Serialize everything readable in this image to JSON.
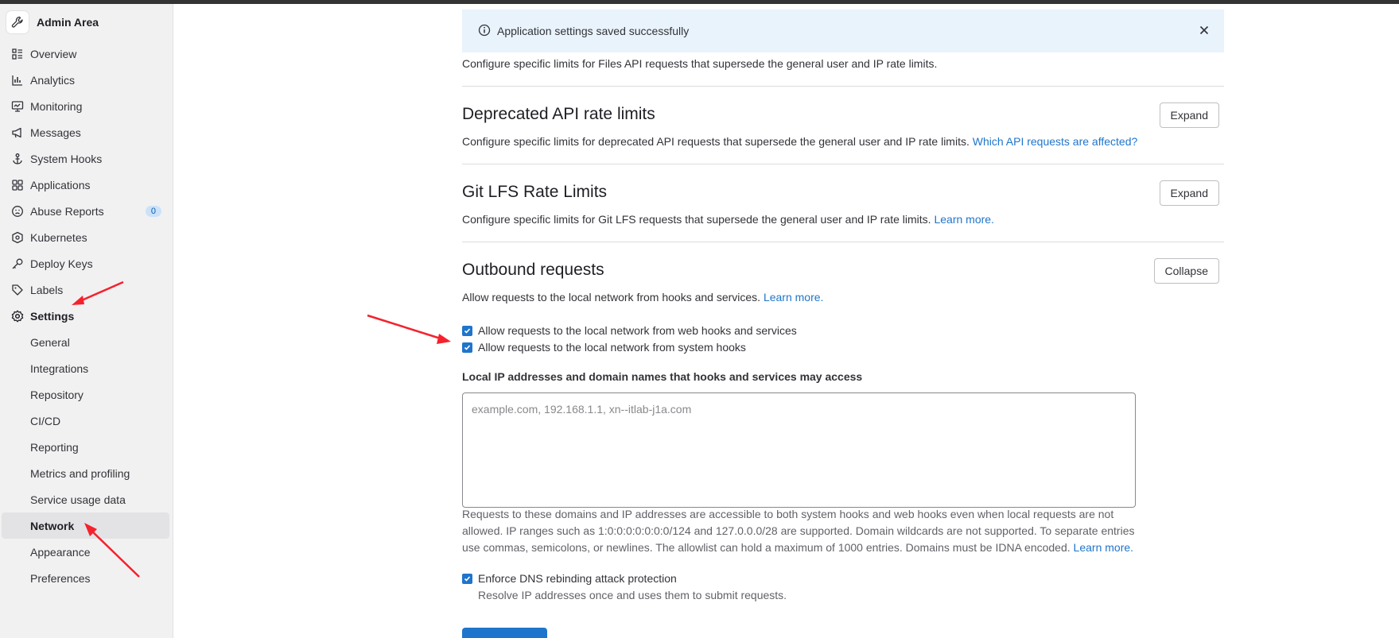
{
  "sidebar": {
    "title": "Admin Area",
    "items": [
      {
        "label": "Overview",
        "icon": "overview-icon"
      },
      {
        "label": "Analytics",
        "icon": "analytics-icon"
      },
      {
        "label": "Monitoring",
        "icon": "monitoring-icon"
      },
      {
        "label": "Messages",
        "icon": "messages-icon"
      },
      {
        "label": "System Hooks",
        "icon": "hook-icon"
      },
      {
        "label": "Applications",
        "icon": "applications-icon"
      },
      {
        "label": "Abuse Reports",
        "icon": "abuse-icon",
        "badge": "0"
      },
      {
        "label": "Kubernetes",
        "icon": "kubernetes-icon"
      },
      {
        "label": "Deploy Keys",
        "icon": "key-icon"
      },
      {
        "label": "Labels",
        "icon": "label-icon"
      },
      {
        "label": "Settings",
        "icon": "settings-icon"
      }
    ],
    "settings_sub": [
      "General",
      "Integrations",
      "Repository",
      "CI/CD",
      "Reporting",
      "Metrics and profiling",
      "Service usage data",
      "Network",
      "Appearance",
      "Preferences"
    ],
    "active": "Network"
  },
  "alert": {
    "text": "Application settings saved successfully"
  },
  "files_api": {
    "description": "Configure specific limits for Files API requests that supersede the general user and IP rate limits."
  },
  "deprecated": {
    "title": "Deprecated API rate limits",
    "description": "Configure specific limits for deprecated API requests that supersede the general user and IP rate limits.",
    "link": "Which API requests are affected?",
    "button": "Expand"
  },
  "lfs": {
    "title": "Git LFS Rate Limits",
    "description": "Configure specific limits for Git LFS requests that supersede the general user and IP rate limits.",
    "link": "Learn more.",
    "button": "Expand"
  },
  "outbound": {
    "title": "Outbound requests",
    "description": "Allow requests to the local network from hooks and services.",
    "link": "Learn more.",
    "button": "Collapse",
    "checkbox_webhooks": "Allow requests to the local network from web hooks and services",
    "checkbox_systemhooks": "Allow requests to the local network from system hooks",
    "allowlist_label": "Local IP addresses and domain names that hooks and services may access",
    "allowlist_placeholder": "example.com, 192.168.1.1, xn--itlab-j1a.com",
    "allowlist_help": "Requests to these domains and IP addresses are accessible to both system hooks and web hooks even when local requests are not allowed. IP ranges such as 1:0:0:0:0:0:0:0/124 and 127.0.0.0/28 are supported. Domain wildcards are not supported. To separate entries use commas, semicolons, or newlines. The allowlist can hold a maximum of 1000 entries. Domains must be IDNA encoded.",
    "allowlist_help_link": "Learn more.",
    "dns_checkbox": "Enforce DNS rebinding attack protection",
    "dns_help": "Resolve IP addresses once and uses them to submit requests."
  },
  "colors": {
    "accent": "#1f75cb",
    "alert_bg": "#e9f3fc",
    "annotation_arrow": "#f5222d"
  }
}
